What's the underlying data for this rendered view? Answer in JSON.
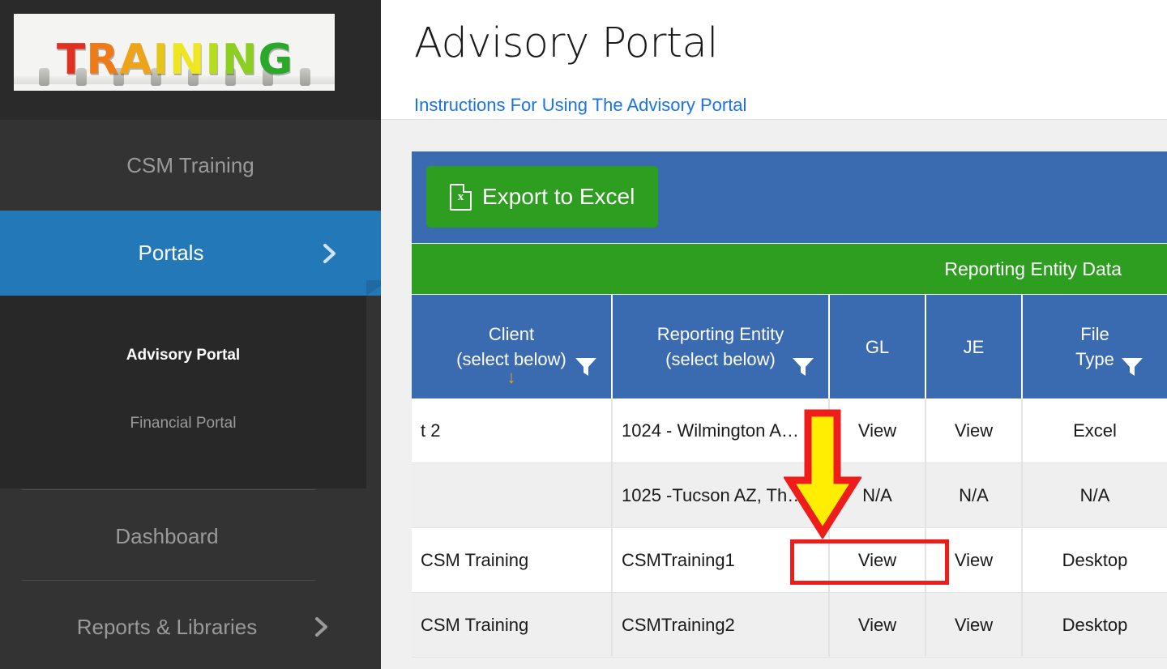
{
  "sidebar": {
    "logo": {
      "alt": "TRAINING",
      "letters": [
        {
          "ch": "T",
          "color": "#e03020"
        },
        {
          "ch": "R",
          "color": "#ef7b18"
        },
        {
          "ch": "A",
          "color": "#efa318"
        },
        {
          "ch": "I",
          "color": "#e8c418"
        },
        {
          "ch": "N",
          "color": "#ede620"
        },
        {
          "ch": "I",
          "color": "#b6dc1e"
        },
        {
          "ch": "N",
          "color": "#8ccf20"
        },
        {
          "ch": "G",
          "color": "#2aa82a"
        }
      ]
    },
    "title": "CSM Training",
    "active_item": {
      "label": "Portals",
      "icon": "chevron-right-icon"
    },
    "submenu": [
      {
        "label": "Advisory Portal",
        "active": true
      },
      {
        "label": "Financial Portal",
        "active": false
      }
    ],
    "items": [
      {
        "label": "Dashboard",
        "icon": ""
      },
      {
        "label": "Reports & Libraries",
        "icon": "chevron-right-icon"
      }
    ]
  },
  "header": {
    "title": "Advisory Portal",
    "instructions_link": "Instructions For Using The Advisory Portal"
  },
  "toolbar": {
    "export_label": "Export to Excel",
    "export_icon": "excel-file-icon"
  },
  "grid": {
    "group_band_label": "Reporting Entity Data",
    "columns": [
      {
        "label": "Client\n(select below)",
        "line1": "Client",
        "line2": "(select below)",
        "filter_icon": "filter-funnel-icon",
        "sort_icon": "sort-descending-arrow"
      },
      {
        "label": "Reporting Entity\n(select below)",
        "line1": "Reporting Entity",
        "line2": "(select below)",
        "filter_icon": "filter-funnel-icon"
      },
      {
        "label": "GL",
        "line1": "GL",
        "line2": ""
      },
      {
        "label": "JE",
        "line1": "JE",
        "line2": ""
      },
      {
        "label": "File\nType",
        "line1": "File",
        "line2": "Type",
        "filter_icon": "filter-funnel-icon"
      }
    ],
    "rows": [
      {
        "client": "t      2",
        "entity": "1024 - Wilmington A…",
        "gl": "View",
        "je": "View",
        "file_type": "Excel"
      },
      {
        "client": "",
        "entity": "1025 -Tucson AZ, Th…",
        "gl": "N/A",
        "je": "N/A",
        "file_type": "N/A"
      },
      {
        "client": "CSM Training",
        "entity": "CSMTraining1",
        "gl": "View",
        "je": "View",
        "file_type": "Desktop"
      },
      {
        "client": "CSM Training",
        "entity": "CSMTraining2",
        "gl": "View",
        "je": "View",
        "file_type": "Desktop"
      }
    ]
  },
  "annotations": {
    "arrow": {
      "type": "down-arrow",
      "fill": "#ffee00",
      "stroke": "#ef1c1c"
    },
    "highlight_box": {
      "type": "rectangle",
      "stroke": "#ef1c1c",
      "target": "CSM Training"
    }
  },
  "colors": {
    "sidebar_bg": "#333333",
    "sidebar_active": "#2378b8",
    "submenu_bg": "#282828",
    "toolbar_blue": "#3a6ab0",
    "accent_green": "#2d9e1f",
    "link_blue": "#1a73e8",
    "annotation_red": "#ef1c1c",
    "annotation_yellow": "#ffee00"
  }
}
